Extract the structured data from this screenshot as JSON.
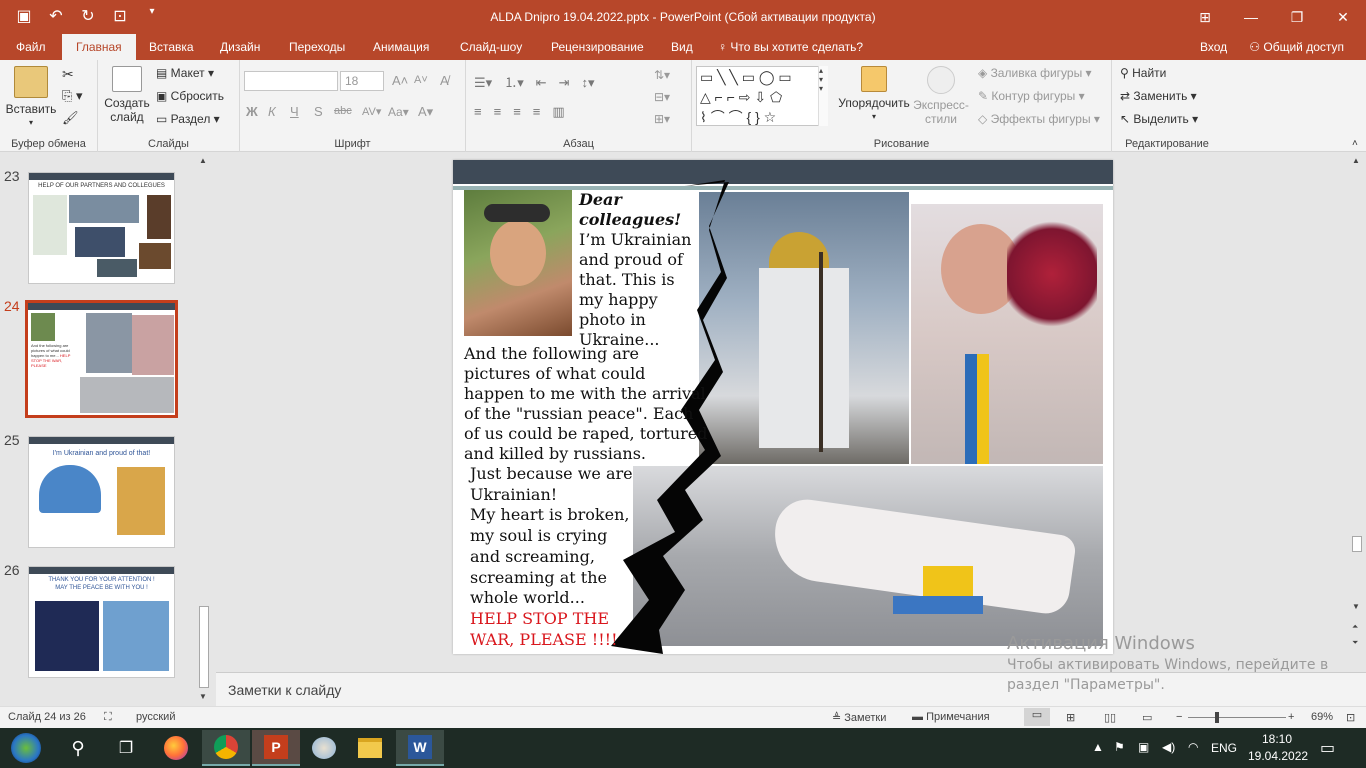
{
  "window": {
    "title": "ALDA Dnipro 19.04.2022.pptx - PowerPoint (Сбой активации продукта)",
    "qat_icons": [
      "save-icon",
      "undo-icon",
      "redo-icon",
      "present-icon",
      "customize-icon"
    ]
  },
  "tabs": {
    "file": "Файл",
    "home": "Главная",
    "insert": "Вставка",
    "design": "Дизайн",
    "transitions": "Переходы",
    "animations": "Анимация",
    "slideshow": "Слайд-шоу",
    "review": "Рецензирование",
    "view": "Вид",
    "tellme": "Что вы хотите сделать?",
    "signin": "Вход",
    "share": "Общий доступ"
  },
  "ribbon": {
    "clipboard": {
      "paste": "Вставить",
      "label": "Буфер обмена"
    },
    "slides": {
      "new_slide_1": "Создать",
      "new_slide_2": "слайд",
      "layout": "Макет",
      "reset": "Сбросить",
      "section": "Раздел",
      "label": "Слайды"
    },
    "font": {
      "size": "18",
      "label": "Шрифт",
      "bold": "Ж",
      "italic": "К",
      "underline": "Ч",
      "strike": "S",
      "abc": "abc",
      "spacing": "AV",
      "case": "Aa",
      "grow": "A",
      "shrink": "A"
    },
    "paragraph": {
      "label": "Абзац"
    },
    "drawing": {
      "arrange": "Упорядочить",
      "styles_1": "Экспресс-",
      "styles_2": "стили",
      "fill": "Заливка фигуры",
      "outline": "Контур фигуры",
      "effects": "Эффекты фигуры",
      "label": "Рисование"
    },
    "editing": {
      "find": "Найти",
      "replace": "Заменить",
      "select": "Выделить",
      "label": "Редактирование"
    }
  },
  "thumbnails": [
    {
      "num": "23",
      "title": "HELP OF OUR PARTNERS AND COLLEGUES",
      "selected": false
    },
    {
      "num": "24",
      "title": "",
      "selected": true
    },
    {
      "num": "25",
      "title": "I'm Ukrainian and proud of  that!",
      "selected": false
    },
    {
      "num": "26",
      "title": "THANK YOU FOR YOUR ATTENTION !\nMAY THE PEACE BE WITH YOU !",
      "selected": false
    }
  ],
  "slide": {
    "heading": "Dear\ncolleagues!",
    "intro": "I’m Ukrainian\nand proud of\nthat. This is\nmy happy\nphoto in\nUkraine...",
    "body": "And the following are\npictures of what could\nhappen to me with the arrival\nof the \"russian peace\".  Each\nof us could be raped, tortured\nand killed by russians.",
    "body2": "Just because we are\nUkrainian!\nMy heart is broken,\nmy soul is crying\nand screaming,\nscreaming at the\nwhole world...",
    "appeal": "HELP STOP THE\nWAR, PLEASE !!!!"
  },
  "notes": {
    "placeholder": "Заметки к слайду"
  },
  "status": {
    "slide_info": "Слайд 24 из 26",
    "language": "русский",
    "notes": "Заметки",
    "comments": "Примечания",
    "zoom": "69%"
  },
  "watermark": {
    "title": "Активация Windows",
    "line1": "Чтобы активировать Windows, перейдите в",
    "line2": "раздел \"Параметры\"."
  },
  "taskbar": {
    "lang": "ENG",
    "time": "18:10",
    "date": "19.04.2022"
  }
}
